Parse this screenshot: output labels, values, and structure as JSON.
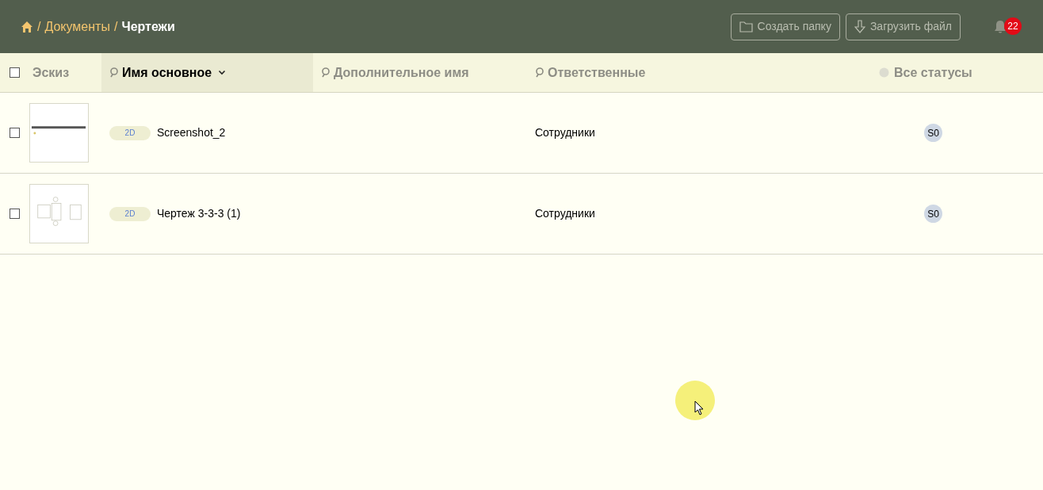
{
  "breadcrumb": {
    "items": [
      {
        "label": "Документы",
        "current": false
      },
      {
        "label": "Чертежи",
        "current": true
      }
    ],
    "separator": "/"
  },
  "toolbar": {
    "buttons": [
      {
        "label": "Создать папку",
        "kind": "folder"
      },
      {
        "label": "Загрузить файл",
        "kind": "upload"
      }
    ],
    "notifications": {
      "count": "22"
    }
  },
  "table": {
    "select_all": {
      "checked": false
    },
    "columns": [
      {
        "label": "Эскиз",
        "kind": "plain",
        "selected": false
      },
      {
        "label": "Имя основное",
        "kind": "search",
        "selected": true
      },
      {
        "label": "Дополнительное имя",
        "kind": "search",
        "selected": false
      },
      {
        "label": "Ответственные",
        "kind": "search",
        "selected": false
      },
      {
        "label": "Все статусы",
        "kind": "status",
        "selected": false
      }
    ],
    "rows": [
      {
        "checked": false,
        "kind": "line",
        "type": "2D",
        "name": "Screenshot_2",
        "responsible": "Сотрудники",
        "status": "S0"
      },
      {
        "checked": false,
        "kind": "plan",
        "type": "2D",
        "name": "Чертеж 3-3-3 (1)",
        "responsible": "Сотрудники",
        "status": "S0"
      }
    ]
  }
}
